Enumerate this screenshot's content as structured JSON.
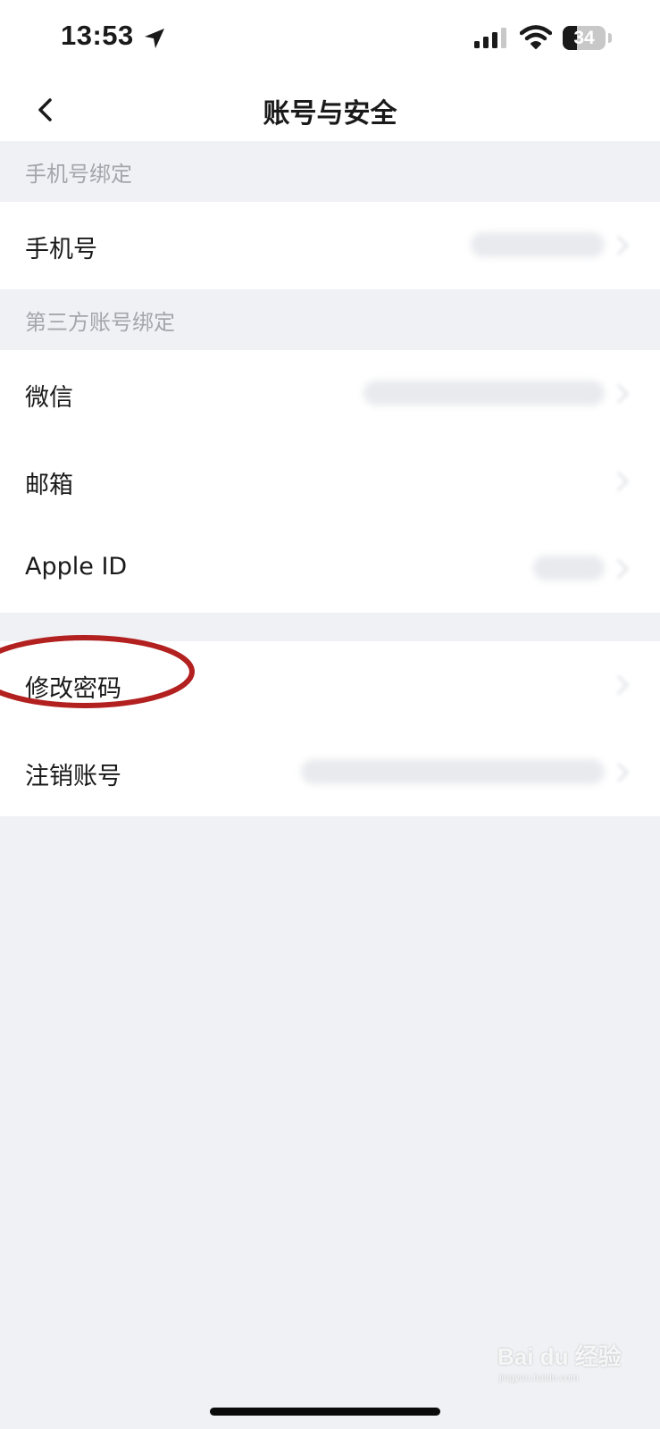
{
  "status_bar": {
    "time": "13:53",
    "battery_text": "34",
    "battery_level": 0.34
  },
  "nav": {
    "title": "账号与安全",
    "back_icon": "chevron-left-icon"
  },
  "sections": {
    "phone_header": "手机号绑定",
    "third_party_header": "第三方账号绑定"
  },
  "rows": {
    "phone": "手机号",
    "wechat": "微信",
    "email": "邮箱",
    "apple_id": "Apple ID",
    "change_password": "修改密码",
    "delete_account": "注销账号"
  },
  "watermark": {
    "brand": "Bai du 经验",
    "url": "jingyan.baidu.com"
  },
  "colors": {
    "background": "#f0f1f5",
    "row_background": "#ffffff",
    "annotation": "#b2201f",
    "section_text": "#a4a6ab"
  }
}
